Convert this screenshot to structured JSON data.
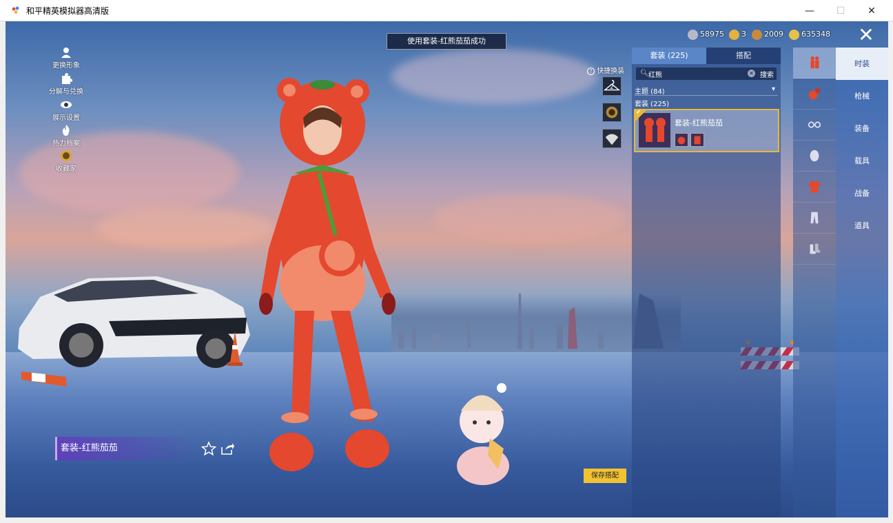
{
  "window": {
    "title": "和平精英模拟器高清版",
    "minimize": "—",
    "maximize": "☐",
    "close": "✕"
  },
  "banner": "使用套装-红熊茄茄成功",
  "left_menu": [
    {
      "label": "更换形象",
      "icon": "person-icon"
    },
    {
      "label": "分解与兑换",
      "icon": "puzzle-icon"
    },
    {
      "label": "展示设置",
      "icon": "eye-icon"
    },
    {
      "label": "热力档案",
      "icon": "flame-icon"
    },
    {
      "label": "收藏家",
      "icon": "collector-badge-icon"
    }
  ],
  "currency": [
    {
      "value": "58975",
      "icon": "silver-coin-icon",
      "color": "#b8b8c8"
    },
    {
      "value": "3",
      "icon": "gold-token-icon",
      "color": "#e3b23c"
    },
    {
      "value": "2009",
      "icon": "bronze-coin-icon",
      "color": "#c98a3a"
    },
    {
      "value": "635348",
      "icon": "gold-coin-icon",
      "color": "#e6c24a"
    }
  ],
  "close": "✕",
  "quick_change": {
    "label": "快捷换装",
    "help": "?",
    "slot_count": "2"
  },
  "panel": {
    "tabs": [
      "套装 (225)",
      "搭配"
    ],
    "search": {
      "value": "红熊",
      "button": "搜索"
    },
    "theme": "主题 (84)",
    "suits": "套装 (225)",
    "item": {
      "name": "套装-红熊茄茄"
    }
  },
  "icon_column": [
    "outfit-icon",
    "grenade-icon",
    "goggles-icon",
    "face-icon",
    "shirt-icon",
    "pants-icon",
    "shoes-icon"
  ],
  "right_menu": [
    "时装",
    "枪械",
    "装备",
    "载具",
    "战备",
    "道具"
  ],
  "outfit_label": "套装-红熊茄茄",
  "save_button": "保存搭配",
  "colors": {
    "accent": "#e8b83a",
    "panel": "#2b4a88",
    "outfit_red": "#e0442a"
  }
}
